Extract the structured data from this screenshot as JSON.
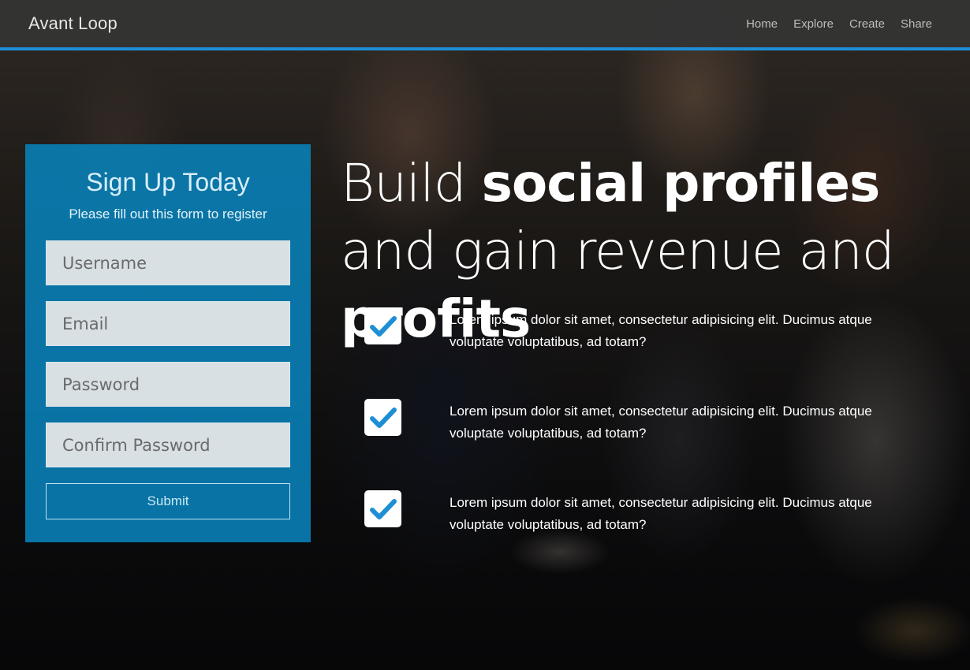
{
  "navbar": {
    "brand": "Avant Loop",
    "links": [
      {
        "label": "Home"
      },
      {
        "label": "Explore"
      },
      {
        "label": "Create"
      },
      {
        "label": "Share"
      }
    ],
    "accent_color": "#1e8fd5"
  },
  "signup": {
    "title": "Sign Up Today",
    "subtitle": "Please fill out this form to register",
    "fields": [
      {
        "placeholder": "Username",
        "value": ""
      },
      {
        "placeholder": "Email",
        "value": ""
      },
      {
        "placeholder": "Password",
        "value": ""
      },
      {
        "placeholder": "Confirm Password",
        "value": ""
      }
    ],
    "submit_label": "Submit",
    "panel_color": "#0882b9"
  },
  "hero": {
    "title_parts": [
      {
        "text": "Build ",
        "bold": false
      },
      {
        "text": "social profiles",
        "bold": true
      },
      {
        "text": " and gain revenue and ",
        "bold": false
      },
      {
        "text": "profits",
        "bold": true
      }
    ],
    "features": [
      {
        "icon": "check-icon",
        "text": "Lorem ipsum dolor sit amet, consectetur adipisicing elit. Ducimus atque voluptate voluptatibus, ad totam?"
      },
      {
        "icon": "check-icon",
        "text": "Lorem ipsum dolor sit amet, consectetur adipisicing elit. Ducimus atque voluptate voluptatibus, ad totam?"
      },
      {
        "icon": "check-icon",
        "text": "Lorem ipsum dolor sit amet, consectetur adipisicing elit. Ducimus atque voluptate voluptatibus, ad totam?"
      }
    ],
    "check_color": "#1e8fd5"
  }
}
